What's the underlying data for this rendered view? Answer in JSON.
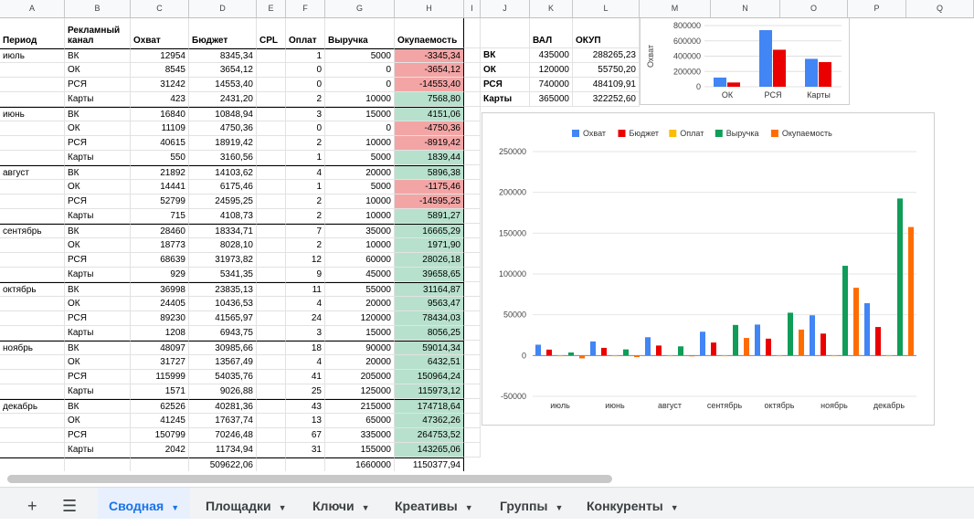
{
  "columns": [
    "A",
    "B",
    "C",
    "D",
    "E",
    "F",
    "G",
    "H",
    "I",
    "J",
    "K",
    "L",
    "M",
    "N",
    "O",
    "P",
    "Q"
  ],
  "headers": [
    "Период",
    "Рекламный канал",
    "Охват",
    "Бюджет",
    "CPL",
    "Оплат",
    "Выручка",
    "Окупаемость"
  ],
  "rows": [
    [
      "июль",
      "ВК",
      "12954",
      "8345,34",
      "",
      "1",
      "5000",
      "-3345,34"
    ],
    [
      "",
      "ОК",
      "8545",
      "3654,12",
      "",
      "0",
      "0",
      "-3654,12"
    ],
    [
      "",
      "РСЯ",
      "31242",
      "14553,40",
      "",
      "0",
      "0",
      "-14553,40"
    ],
    [
      "",
      "Карты",
      "423",
      "2431,20",
      "",
      "2",
      "10000",
      "7568,80"
    ],
    [
      "июнь",
      "ВК",
      "16840",
      "10848,94",
      "",
      "3",
      "15000",
      "4151,06"
    ],
    [
      "",
      "ОК",
      "11109",
      "4750,36",
      "",
      "0",
      "0",
      "-4750,36"
    ],
    [
      "",
      "РСЯ",
      "40615",
      "18919,42",
      "",
      "2",
      "10000",
      "-8919,42"
    ],
    [
      "",
      "Карты",
      "550",
      "3160,56",
      "",
      "1",
      "5000",
      "1839,44"
    ],
    [
      "август",
      "ВК",
      "21892",
      "14103,62",
      "",
      "4",
      "20000",
      "5896,38"
    ],
    [
      "",
      "ОК",
      "14441",
      "6175,46",
      "",
      "1",
      "5000",
      "-1175,46"
    ],
    [
      "",
      "РСЯ",
      "52799",
      "24595,25",
      "",
      "2",
      "10000",
      "-14595,25"
    ],
    [
      "",
      "Карты",
      "715",
      "4108,73",
      "",
      "2",
      "10000",
      "5891,27"
    ],
    [
      "сентябрь",
      "ВК",
      "28460",
      "18334,71",
      "",
      "7",
      "35000",
      "16665,29"
    ],
    [
      "",
      "ОК",
      "18773",
      "8028,10",
      "",
      "2",
      "10000",
      "1971,90"
    ],
    [
      "",
      "РСЯ",
      "68639",
      "31973,82",
      "",
      "12",
      "60000",
      "28026,18"
    ],
    [
      "",
      "Карты",
      "929",
      "5341,35",
      "",
      "9",
      "45000",
      "39658,65"
    ],
    [
      "октябрь",
      "ВК",
      "36998",
      "23835,13",
      "",
      "11",
      "55000",
      "31164,87"
    ],
    [
      "",
      "ОК",
      "24405",
      "10436,53",
      "",
      "4",
      "20000",
      "9563,47"
    ],
    [
      "",
      "РСЯ",
      "89230",
      "41565,97",
      "",
      "24",
      "120000",
      "78434,03"
    ],
    [
      "",
      "Карты",
      "1208",
      "6943,75",
      "",
      "3",
      "15000",
      "8056,25"
    ],
    [
      "ноябрь",
      "ВК",
      "48097",
      "30985,66",
      "",
      "18",
      "90000",
      "59014,34"
    ],
    [
      "",
      "ОК",
      "31727",
      "13567,49",
      "",
      "4",
      "20000",
      "6432,51"
    ],
    [
      "",
      "РСЯ",
      "115999",
      "54035,76",
      "",
      "41",
      "205000",
      "150964,24"
    ],
    [
      "",
      "Карты",
      "1571",
      "9026,88",
      "",
      "25",
      "125000",
      "115973,12"
    ],
    [
      "декабрь",
      "ВК",
      "62526",
      "40281,36",
      "",
      "43",
      "215000",
      "174718,64"
    ],
    [
      "",
      "ОК",
      "41245",
      "17637,74",
      "",
      "13",
      "65000",
      "47362,26"
    ],
    [
      "",
      "РСЯ",
      "150799",
      "70246,48",
      "",
      "67",
      "335000",
      "264753,52"
    ],
    [
      "",
      "Карты",
      "2042",
      "11734,94",
      "",
      "31",
      "155000",
      "143265,06"
    ]
  ],
  "totals": {
    "budget": "509622,06",
    "revenue": "1660000",
    "payback": "1150377,94"
  },
  "summary": {
    "headers": [
      "ВАЛ",
      "ОКУП"
    ],
    "rows": [
      [
        "ВК",
        "435000",
        "288265,23"
      ],
      [
        "ОК",
        "120000",
        "55750,20"
      ],
      [
        "РСЯ",
        "740000",
        "484109,91"
      ],
      [
        "Карты",
        "365000",
        "322252,60"
      ]
    ]
  },
  "chart_data": [
    {
      "type": "bar",
      "categories": [
        "ОК",
        "РСЯ",
        "Карты"
      ],
      "ylabel": "Охват",
      "ylim": [
        0,
        800000
      ],
      "yticks": [
        "0",
        "200000",
        "400000",
        "600000",
        "800000"
      ],
      "series": [
        {
          "values": [
            120000,
            740000,
            365000
          ],
          "color": "#4285f4"
        },
        {
          "values": [
            55750,
            484110,
            322253
          ],
          "color": "#ea0000"
        }
      ]
    },
    {
      "type": "bar",
      "categories": [
        "июль",
        "июнь",
        "август",
        "сентябрь",
        "октябрь",
        "ноябрь",
        "декабрь"
      ],
      "ylim": [
        -50000,
        250000
      ],
      "yticks": [
        "-50000",
        "0",
        "50000",
        "100000",
        "150000",
        "200000",
        "250000"
      ],
      "legend_position": "top",
      "series": [
        {
          "name": "Охват",
          "color": "#4285f4",
          "values": [
            13291,
            17279,
            22462,
            29200,
            37960,
            49349,
            64154
          ]
        },
        {
          "name": "Бюджет",
          "color": "#ea0000",
          "values": [
            7246,
            9420,
            12246,
            15920,
            20695,
            26904,
            34975
          ]
        },
        {
          "name": "Оплат",
          "color": "#fbbc04",
          "values": [
            1,
            2,
            2,
            8,
            11,
            22,
            39
          ]
        },
        {
          "name": "Выручка",
          "color": "#0f9d58",
          "values": [
            3750,
            7500,
            11250,
            37500,
            52500,
            110000,
            192500
          ]
        },
        {
          "name": "Окупаемость",
          "color": "#ff6d00",
          "values": [
            -3496,
            -1920,
            -996,
            21580,
            31804,
            83096,
            157525
          ]
        }
      ]
    }
  ],
  "tabs": [
    "Сводная",
    "Площадки",
    "Ключи",
    "Креативы",
    "Группы",
    "Конкуренты"
  ],
  "active_tab": "Сводная",
  "icons": {
    "add": "+",
    "menu": "☰",
    "dropdown": "▼"
  }
}
